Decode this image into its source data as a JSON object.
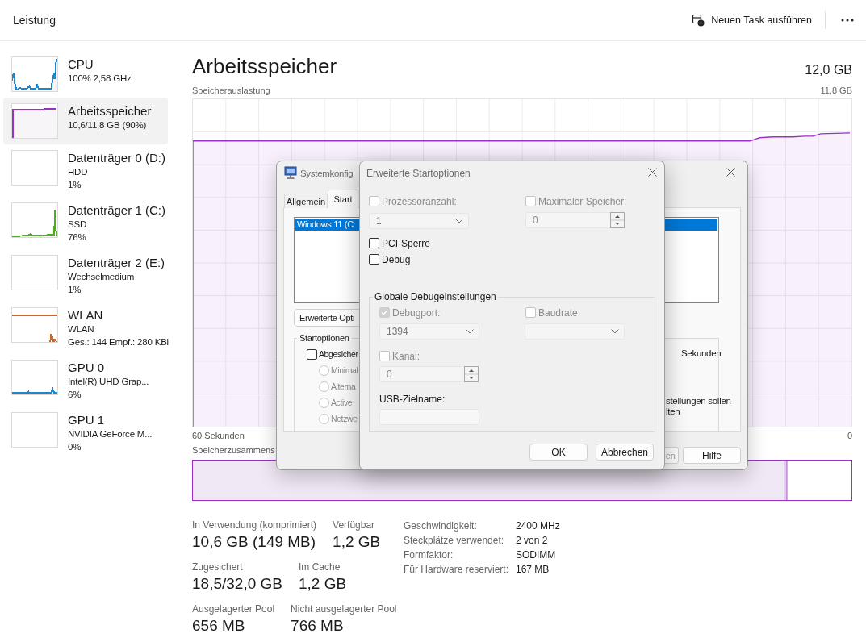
{
  "header": {
    "title": "Leistung",
    "new_task": "Neuen Task ausführen"
  },
  "sidebar": {
    "items": [
      {
        "title": "CPU",
        "lines": [
          "100%  2,58 GHz"
        ],
        "color": "#1a86d0",
        "selected": false
      },
      {
        "title": "Arbeitsspeicher",
        "lines": [
          "10,6/11,8 GB (90%)"
        ],
        "color": "#9b30c8",
        "selected": true
      },
      {
        "title": "Datenträger 0 (D:)",
        "lines": [
          "HDD",
          "1%"
        ],
        "selected": false
      },
      {
        "title": "Datenträger 1 (C:)",
        "lines": [
          "SSD",
          "76%"
        ],
        "color": "#4caf1f",
        "selected": false
      },
      {
        "title": "Datenträger 2 (E:)",
        "lines": [
          "Wechselmedium",
          "1%"
        ],
        "selected": false
      },
      {
        "title": "WLAN",
        "lines": [
          "WLAN",
          "Ges.: 144 Empf.: 280 KBi"
        ],
        "color": "#c8662b",
        "selected": false
      },
      {
        "title": "GPU 0",
        "lines": [
          "Intel(R) UHD Grap...",
          "6%"
        ],
        "color": "#1a86d0",
        "selected": false
      },
      {
        "title": "GPU 1",
        "lines": [
          "NVIDIA GeForce M...",
          "0%"
        ],
        "selected": false
      }
    ]
  },
  "memory": {
    "title": "Arbeitsspeicher",
    "capacity": "12,0 GB",
    "usage_label": "Speicherauslastung",
    "usage_max": "11,8 GB",
    "time_span": "60 Sekunden",
    "time_end": "0",
    "composition_label": "Speicherzusammens",
    "stat_rows": [
      {
        "items": [
          {
            "label": "In Verwendung (komprimiert)",
            "value": "10,6 GB (149 MB)"
          },
          {
            "label": "Verfügbar",
            "value": "1,2 GB"
          }
        ]
      },
      {
        "items": [
          {
            "label": "Zugesichert",
            "value": "18,5/32,0 GB"
          },
          {
            "label": "Im Cache",
            "value": "1,2 GB"
          }
        ]
      },
      {
        "items": [
          {
            "label": "Ausgelagerter Pool",
            "value": "656 MB"
          },
          {
            "label": "Nicht ausgelagerter Pool",
            "value": "766 MB"
          }
        ]
      }
    ],
    "details": [
      {
        "label": "Geschwindigkeit:",
        "value": "2400 MHz"
      },
      {
        "label": "Steckplätze verwendet:",
        "value": "2 von 2"
      },
      {
        "label": "Formfaktor:",
        "value": "SODIMM"
      },
      {
        "label": "Für Hardware reserviert:",
        "value": "167 MB"
      }
    ]
  },
  "system_config": {
    "title": "Systemkonfig",
    "tabs": [
      {
        "label": "Allgemein",
        "selected": false
      },
      {
        "label": "Start",
        "selected": true
      }
    ],
    "boot_entries": [
      {
        "label": "Windows 11 (C:",
        "selected": true
      }
    ],
    "advanced_button": "Erweiterte Opti",
    "boot_options_label": "Startoptionen",
    "safe_boot": {
      "label": "Abgesicher",
      "checked": false
    },
    "safe_boot_modes": [
      {
        "label": "Minimal",
        "selected": false,
        "disabled": true
      },
      {
        "label": "Alterna",
        "selected": false,
        "disabled": true
      },
      {
        "label": "Active",
        "selected": false,
        "disabled": true
      },
      {
        "label": "Netzwe",
        "selected": false,
        "disabled": true
      }
    ],
    "timeout_unit": "Sekunden",
    "note_lines": [
      "stellungen sollen",
      "lten"
    ],
    "buttons": [
      {
        "label": "en",
        "disabled": true
      },
      {
        "label": "Hilfe",
        "disabled": false
      }
    ]
  },
  "advanced_boot": {
    "title": "Erweiterte Startoptionen",
    "processor_count": {
      "label": "Prozessoranzahl:",
      "checked": false,
      "value": "1",
      "disabled": true
    },
    "max_memory": {
      "label": "Maximaler Speicher:",
      "checked": false,
      "value": "0",
      "disabled": true
    },
    "pci_lock": {
      "label": "PCI-Sperre",
      "checked": false
    },
    "debug": {
      "label": "Debug",
      "checked": false
    },
    "debug_settings": {
      "title": "Globale Debugeinstellungen",
      "debug_port": {
        "label": "Debugport:",
        "checked": true,
        "disabled": true,
        "value": "1394"
      },
      "baud_rate": {
        "label": "Baudrate:",
        "checked": false,
        "disabled": true
      },
      "channel": {
        "label": "Kanal:",
        "checked": false,
        "disabled": true,
        "value": "0"
      },
      "usb_target": {
        "label": "USB-Zielname:",
        "disabled": true
      }
    },
    "buttons": [
      "OK",
      "Abbrechen"
    ]
  }
}
